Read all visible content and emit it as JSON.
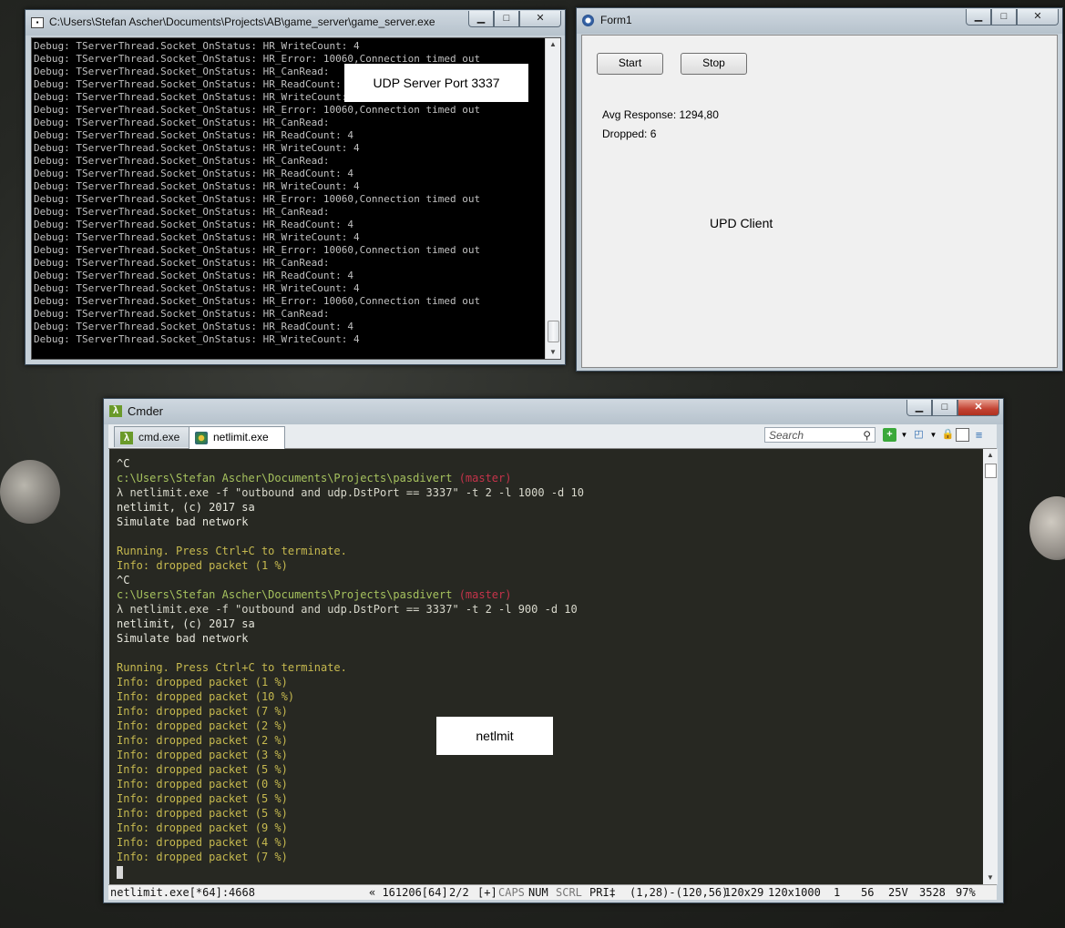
{
  "console_window": {
    "title": "C:\\Users\\Stefan Ascher\\Documents\\Projects\\AB\\game_server\\game_server.exe",
    "lines": [
      "Debug: TServerThread.Socket_OnStatus: HR_WriteCount: 4",
      "Debug: TServerThread.Socket_OnStatus: HR_Error: 10060,Connection timed out",
      "Debug: TServerThread.Socket_OnStatus: HR_CanRead:",
      "Debug: TServerThread.Socket_OnStatus: HR_ReadCount: 4",
      "Debug: TServerThread.Socket_OnStatus: HR_WriteCount: 4",
      "Debug: TServerThread.Socket_OnStatus: HR_Error: 10060,Connection timed out",
      "Debug: TServerThread.Socket_OnStatus: HR_CanRead:",
      "Debug: TServerThread.Socket_OnStatus: HR_ReadCount: 4",
      "Debug: TServerThread.Socket_OnStatus: HR_WriteCount: 4",
      "Debug: TServerThread.Socket_OnStatus: HR_CanRead:",
      "Debug: TServerThread.Socket_OnStatus: HR_ReadCount: 4",
      "Debug: TServerThread.Socket_OnStatus: HR_WriteCount: 4",
      "Debug: TServerThread.Socket_OnStatus: HR_Error: 10060,Connection timed out",
      "Debug: TServerThread.Socket_OnStatus: HR_CanRead:",
      "Debug: TServerThread.Socket_OnStatus: HR_ReadCount: 4",
      "Debug: TServerThread.Socket_OnStatus: HR_WriteCount: 4",
      "Debug: TServerThread.Socket_OnStatus: HR_Error: 10060,Connection timed out",
      "Debug: TServerThread.Socket_OnStatus: HR_CanRead:",
      "Debug: TServerThread.Socket_OnStatus: HR_ReadCount: 4",
      "Debug: TServerThread.Socket_OnStatus: HR_WriteCount: 4",
      "Debug: TServerThread.Socket_OnStatus: HR_Error: 10060,Connection timed out",
      "Debug: TServerThread.Socket_OnStatus: HR_CanRead:",
      "Debug: TServerThread.Socket_OnStatus: HR_ReadCount: 4",
      "Debug: TServerThread.Socket_OnStatus: HR_WriteCount: 4"
    ],
    "overlay_label": "UDP Server Port 3337"
  },
  "form1": {
    "title": "Form1",
    "start_label": "Start",
    "stop_label": "Stop",
    "avg_response": "Avg Response: 1294,80",
    "dropped": "Dropped: 6",
    "overlay_label": "UPD Client"
  },
  "cmder": {
    "title": "Cmder",
    "tabs": [
      {
        "label": "cmd.exe",
        "icon": "lambda-icon"
      },
      {
        "label": "netlimit.exe",
        "icon": "netlimit-icon"
      }
    ],
    "search_placeholder": "Search",
    "overlay_label": "netlmit",
    "status": {
      "process": "netlimit.exe[*64]:4668",
      "hwnd": "« 161206[64]",
      "pages": "2/2",
      "plus": "[+]",
      "caps": "CAPS",
      "num": "NUM",
      "scrl": "SCRL",
      "pri": "PRI‡",
      "sel": "(1,28)-(120,56)",
      "size": "120x29",
      "buffer": "120x1000",
      "one": "1",
      "fifty_six": "56",
      "volt": "25V",
      "num2": "3528",
      "zoom": "97%"
    },
    "terminal": [
      {
        "kind": "white",
        "text": "^C"
      },
      {
        "kind": "prompt",
        "path": "c:\\Users\\Stefan Ascher\\Documents\\Projects\\pasdivert",
        "branch": "(master)"
      },
      {
        "kind": "cmd",
        "text": "λ netlimit.exe -f \"outbound and udp.DstPort == 3337\" -t 2 -l 1000 -d 10"
      },
      {
        "kind": "white",
        "text": "netlimit, (c) 2017 sa"
      },
      {
        "kind": "white",
        "text": "Simulate bad network"
      },
      {
        "kind": "white",
        "text": ""
      },
      {
        "kind": "yellow",
        "text": "Running. Press Ctrl+C to terminate."
      },
      {
        "kind": "yellow",
        "text": "Info: dropped packet (1 %)"
      },
      {
        "kind": "white",
        "text": "^C"
      },
      {
        "kind": "prompt",
        "path": "c:\\Users\\Stefan Ascher\\Documents\\Projects\\pasdivert",
        "branch": "(master)"
      },
      {
        "kind": "cmd",
        "text": "λ netlimit.exe -f \"outbound and udp.DstPort == 3337\" -t 2 -l 900 -d 10"
      },
      {
        "kind": "white",
        "text": "netlimit, (c) 2017 sa"
      },
      {
        "kind": "white",
        "text": "Simulate bad network"
      },
      {
        "kind": "white",
        "text": ""
      },
      {
        "kind": "yellow",
        "text": "Running. Press Ctrl+C to terminate."
      },
      {
        "kind": "yellow",
        "text": "Info: dropped packet (1 %)"
      },
      {
        "kind": "yellow",
        "text": "Info: dropped packet (10 %)"
      },
      {
        "kind": "yellow",
        "text": "Info: dropped packet (7 %)"
      },
      {
        "kind": "yellow",
        "text": "Info: dropped packet (2 %)"
      },
      {
        "kind": "yellow",
        "text": "Info: dropped packet (2 %)"
      },
      {
        "kind": "yellow",
        "text": "Info: dropped packet (3 %)"
      },
      {
        "kind": "yellow",
        "text": "Info: dropped packet (5 %)"
      },
      {
        "kind": "yellow",
        "text": "Info: dropped packet (0 %)"
      },
      {
        "kind": "yellow",
        "text": "Info: dropped packet (5 %)"
      },
      {
        "kind": "yellow",
        "text": "Info: dropped packet (5 %)"
      },
      {
        "kind": "yellow",
        "text": "Info: dropped packet (9 %)"
      },
      {
        "kind": "yellow",
        "text": "Info: dropped packet (4 %)"
      },
      {
        "kind": "yellow",
        "text": "Info: dropped packet (7 %)"
      }
    ]
  }
}
